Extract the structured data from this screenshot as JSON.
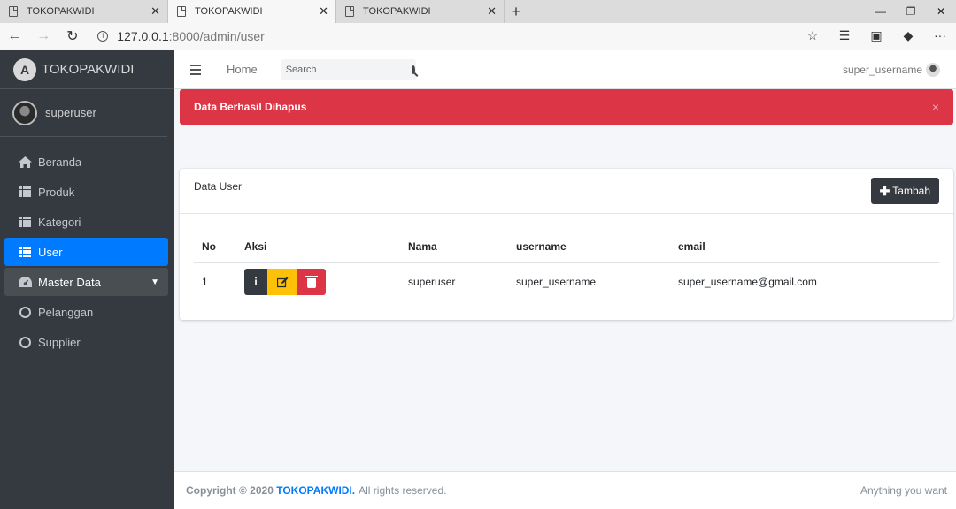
{
  "browser": {
    "tabs": [
      {
        "title": "TOKOPAKWIDI",
        "active": false
      },
      {
        "title": "TOKOPAKWIDI",
        "active": true
      },
      {
        "title": "TOKOPAKWIDI",
        "active": false
      }
    ],
    "url_host": "127.0.0.1",
    "url_rest": ":8000/admin/user"
  },
  "sidebar": {
    "brand": "TOKOPAKWIDI",
    "user": "superuser",
    "items": [
      {
        "label": "Beranda",
        "icon": "home-icon"
      },
      {
        "label": "Produk",
        "icon": "grid-icon"
      },
      {
        "label": "Kategori",
        "icon": "grid-icon"
      },
      {
        "label": "User",
        "icon": "grid-icon",
        "active": true
      },
      {
        "label": "Master Data",
        "icon": "dashboard-icon",
        "expanded": true
      },
      {
        "label": "Pelanggan",
        "icon": "circle-icon"
      },
      {
        "label": "Supplier",
        "icon": "circle-icon"
      }
    ]
  },
  "topnav": {
    "home": "Home",
    "search_placeholder": "Search",
    "username": "super_username"
  },
  "alert": {
    "message": "Data Berhasil Dihapus",
    "close": "×"
  },
  "card": {
    "title": "Data User",
    "add_label": "Tambah",
    "columns": [
      "No",
      "Aksi",
      "Nama",
      "username",
      "email"
    ],
    "rows": [
      {
        "no": "1",
        "nama": "superuser",
        "username": "super_username",
        "email": "super_username@gmail.com"
      }
    ]
  },
  "footer": {
    "copyright": "Copyright © 2020",
    "brand": "TOKOPAKWIDI.",
    "rights": "All rights reserved.",
    "tagline": "Anything you want"
  },
  "colors": {
    "sidebar": "#343a40",
    "primary": "#007bff",
    "danger": "#dc3545",
    "warning": "#ffc107",
    "dark": "#343a40"
  }
}
